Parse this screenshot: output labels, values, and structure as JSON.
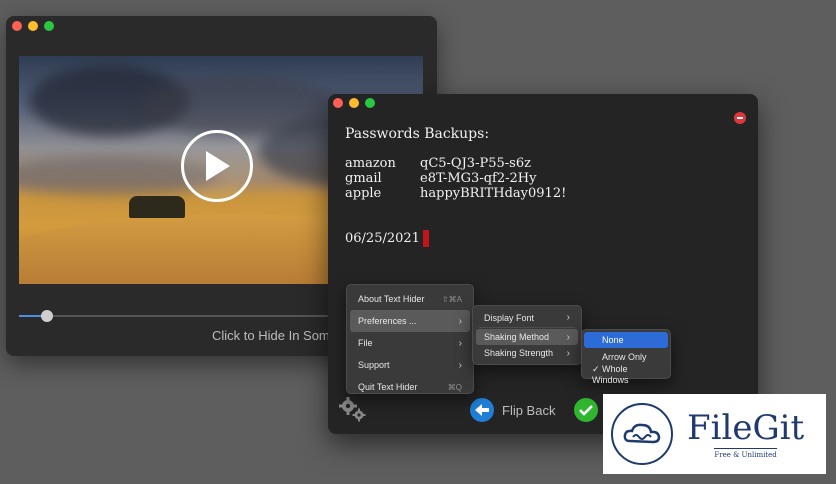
{
  "back_window": {
    "hide_label": "Click to Hide In Some"
  },
  "front_window": {
    "title": "Passwords Backups:",
    "passwords": [
      {
        "site": "amazon",
        "password": "qC5-QJ3-P55-s6z"
      },
      {
        "site": "gmail",
        "password": "e8T-MG3-qf2-2Hy"
      },
      {
        "site": "apple",
        "password": "happyBRITHday0912!"
      }
    ],
    "date": "06/25/2021",
    "flip_back_label": "Flip Back"
  },
  "menu_main": {
    "items": [
      {
        "label": "About Text Hider",
        "shortcut": "⇧⌘A"
      },
      {
        "label": "Preferences ...",
        "submenu": true
      },
      {
        "label": "File",
        "submenu": true
      },
      {
        "label": "Support",
        "submenu": true
      },
      {
        "label": "Quit Text Hider",
        "shortcut": "⌘Q"
      }
    ]
  },
  "menu_preferences": {
    "items": [
      {
        "label": "Display Font"
      },
      {
        "label": "Shaking Method"
      },
      {
        "label": "Shaking Strength"
      }
    ]
  },
  "menu_shaking": {
    "items": [
      {
        "label": "None",
        "selected": true
      },
      {
        "label": "Arrow Only"
      },
      {
        "label": "Whole Windows",
        "checked": true
      }
    ],
    "check_mark": "✓"
  },
  "video": {
    "progress": 0.07
  },
  "watermark": {
    "name": "FileGit",
    "tagline": "Free & Unlimited"
  },
  "colors": {
    "accent": "#4a90e2",
    "cursor": "#c0161b",
    "close": "#e0373c",
    "confirm": "#2fb52f",
    "brand": "#1e3a6e"
  }
}
